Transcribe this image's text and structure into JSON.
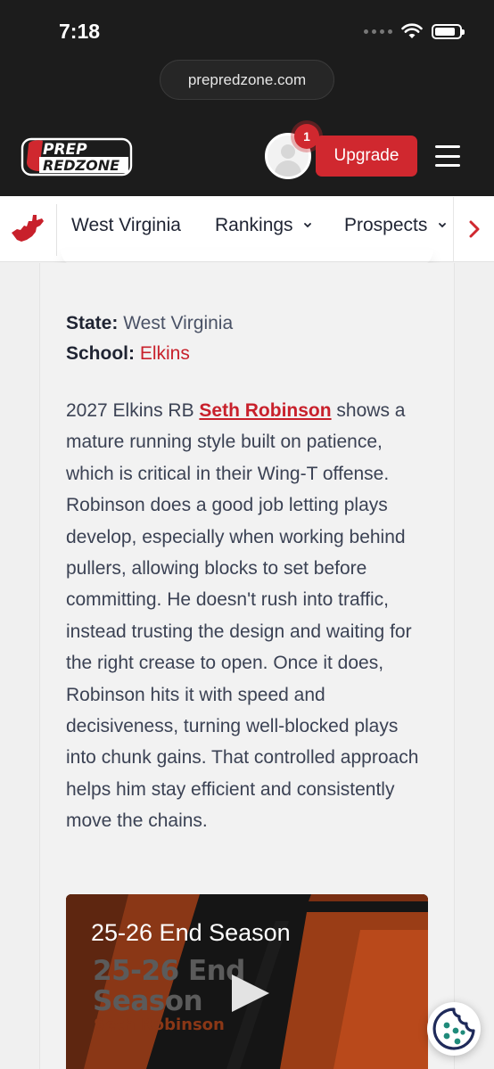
{
  "status_bar": {
    "time": "7:18"
  },
  "browser": {
    "url": "prepredzone.com"
  },
  "header": {
    "logo_text_top": "PREP",
    "logo_text_bottom": "REDZONE",
    "notification_count": "1",
    "upgrade_label": "Upgrade"
  },
  "subnav": {
    "items": [
      {
        "label": "West Virginia"
      },
      {
        "label": "Rankings"
      },
      {
        "label": "Prospects"
      }
    ]
  },
  "meta": {
    "state_label": "State:",
    "state_value": "West Virginia",
    "school_label": "School:",
    "school_value": "Elkins"
  },
  "article": {
    "lead": "2027 Elkins RB ",
    "player_link": "Seth Robinson",
    "body": " shows a mature running style built on patience, which is critical in their Wing-T offense. Robinson does a good job letting plays develop, especially when working behind pullers, allowing blocks to set before committing. He doesn't rush into traffic, instead trusting the design and waiting for the right crease to open. Once it does, Robinson hits it with speed and decisiveness, turning well-blocked plays into chunk gains. That controlled approach helps him stay efficient and consistently move the chains."
  },
  "video": {
    "title": "25-26 End Season",
    "thumb_line1": "25-26 End",
    "thumb_line2": "Season",
    "thumb_line3": "Seth Robinson"
  },
  "colors": {
    "brand_red": "#d0282f",
    "dark_header": "#1c1c1c",
    "link_red": "#c8202b",
    "cookie_teal": "#1f8a7a",
    "cookie_navy": "#1f2a5a"
  },
  "icons": {
    "wifi": "wifi-icon",
    "battery": "battery-icon",
    "menu": "hamburger-menu-icon",
    "state_map": "west-virginia-map-icon",
    "chevron": "chevron-down-icon",
    "next": "chevron-right-icon",
    "play": "play-icon",
    "cookie": "cookie-icon"
  }
}
